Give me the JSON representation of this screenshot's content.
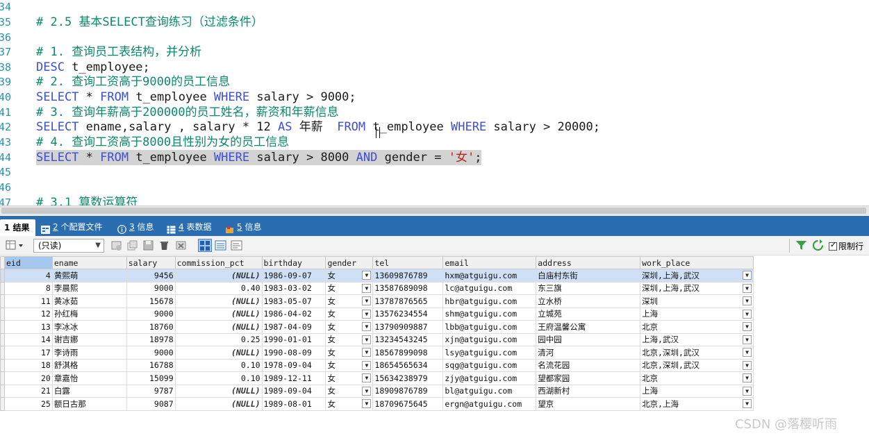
{
  "editor": {
    "lines": [
      {
        "no": "34",
        "segments": []
      },
      {
        "no": "35",
        "segments": [
          {
            "t": "cm",
            "v": "# 2.5 基本SELECT查询练习（过滤条件）"
          }
        ]
      },
      {
        "no": "36",
        "segments": []
      },
      {
        "no": "37",
        "segments": [
          {
            "t": "cm",
            "v": "# 1. 查询员工表结构，并分析"
          }
        ]
      },
      {
        "no": "38",
        "segments": [
          {
            "t": "kw",
            "v": "DESC"
          },
          {
            "t": "tx",
            "v": " t_employee;"
          }
        ]
      },
      {
        "no": "39",
        "segments": [
          {
            "t": "cm",
            "v": "# 2. 查询工资高于9000的员工信息"
          }
        ]
      },
      {
        "no": "40",
        "segments": [
          {
            "t": "kw",
            "v": "SELECT"
          },
          {
            "t": "tx",
            "v": " * "
          },
          {
            "t": "kw",
            "v": "FROM"
          },
          {
            "t": "tx",
            "v": " t_employee "
          },
          {
            "t": "kw",
            "v": "WHERE"
          },
          {
            "t": "tx",
            "v": " salary > 9000;"
          }
        ]
      },
      {
        "no": "41",
        "segments": [
          {
            "t": "cm",
            "v": "# 3. 查询年薪高于200000的员工姓名，薪资和年薪信息"
          }
        ]
      },
      {
        "no": "42",
        "segments": [
          {
            "t": "kw",
            "v": "SELECT"
          },
          {
            "t": "tx",
            "v": " ename,salary , salary * 12 "
          },
          {
            "t": "kw",
            "v": "AS"
          },
          {
            "t": "tx",
            "v": " 年薪  "
          },
          {
            "t": "kw",
            "v": "FROM"
          },
          {
            "t": "tx",
            "v": " t_employee "
          },
          {
            "t": "kw",
            "v": "WHERE"
          },
          {
            "t": "tx",
            "v": " salary > 20000;"
          }
        ]
      },
      {
        "no": "43",
        "segments": [
          {
            "t": "cm",
            "v": "# 4. 查询工资高于8000且性别为女的员工信息"
          }
        ]
      },
      {
        "no": "44",
        "highlight": true,
        "segments": [
          {
            "t": "kw",
            "v": "SELECT"
          },
          {
            "t": "tx",
            "v": " * "
          },
          {
            "t": "kw",
            "v": "FROM"
          },
          {
            "t": "tx",
            "v": " t_employee "
          },
          {
            "t": "kw",
            "v": "WHERE"
          },
          {
            "t": "tx",
            "v": " salary > 8000 "
          },
          {
            "t": "kw",
            "v": "AND"
          },
          {
            "t": "tx",
            "v": " gender = "
          },
          {
            "t": "str",
            "v": "'女'"
          },
          {
            "t": "tx",
            "v": ";"
          }
        ]
      },
      {
        "no": "45",
        "segments": []
      },
      {
        "no": "46",
        "segments": []
      },
      {
        "no": "47",
        "segments": [
          {
            "t": "cm",
            "v": "# 3.1 算数运算符"
          }
        ]
      }
    ]
  },
  "tabs": [
    {
      "num": "1",
      "label": "结果",
      "icon": "result-grid-icon"
    },
    {
      "num": "2",
      "label": "个配置文件",
      "icon": "profile-icon"
    },
    {
      "num": "3",
      "label": "信息",
      "icon": "info-icon"
    },
    {
      "num": "4",
      "label": "表数据",
      "icon": "table-data-icon"
    },
    {
      "num": "5",
      "label": "信息",
      "icon": "info-icon-2"
    }
  ],
  "toolbar": {
    "mode": "(只读)",
    "limit_label": "限制行"
  },
  "grid": {
    "columns": [
      "eid",
      "ename",
      "salary",
      "commission_pct",
      "birthday",
      "gender",
      "tel",
      "email",
      "address",
      "work_place"
    ],
    "rows": [
      [
        "4",
        "黄熙萌",
        "9456",
        "(NULL)",
        "1986-09-07",
        "女",
        "13609876789",
        "hxm@atguigu.com",
        "白庙村东街",
        "深圳,上海,武汉"
      ],
      [
        "8",
        "李晨熙",
        "9000",
        "0.40",
        "1983-03-02",
        "女",
        "13587689098",
        "lc@atguigu.com",
        "东三旗",
        "深圳,上海,武汉"
      ],
      [
        "11",
        "黄冰茹",
        "15678",
        "(NULL)",
        "1983-05-07",
        "女",
        "13787876565",
        "hbr@atguigu.com",
        "立水桥",
        "深圳"
      ],
      [
        "12",
        "孙红梅",
        "9000",
        "(NULL)",
        "1986-04-02",
        "女",
        "13576234554",
        "shm@atguigu.com",
        "立城苑",
        "上海"
      ],
      [
        "13",
        "李冰冰",
        "18760",
        "(NULL)",
        "1987-04-09",
        "女",
        "13790909887",
        "lbb@atguigu.com",
        "王府温馨公寓",
        "北京"
      ],
      [
        "14",
        "谢吉娜",
        "18978",
        "0.25",
        "1990-01-01",
        "女",
        "13234543245",
        "xjn@atguigu.com",
        "园中园",
        "上海,武汉"
      ],
      [
        "17",
        "李诗雨",
        "9000",
        "(NULL)",
        "1990-08-09",
        "女",
        "18567899098",
        "lsy@atguigu.com",
        "清河",
        "北京,深圳,武汉"
      ],
      [
        "18",
        "舒淇格",
        "16788",
        "0.10",
        "1978-09-04",
        "女",
        "18654565634",
        "sqg@atguigu.com",
        "名流花园",
        "北京,深圳,武汉"
      ],
      [
        "20",
        "章嘉怡",
        "15099",
        "0.10",
        "1989-12-11",
        "女",
        "15634238979",
        "zjy@atguigu.com",
        "望都家园",
        "北京"
      ],
      [
        "21",
        "白露",
        "9787",
        "(NULL)",
        "1989-09-04",
        "女",
        "18909876789",
        "bl@atguigu.com",
        "西湖新村",
        "上海"
      ],
      [
        "25",
        "额日古那",
        "9087",
        "(NULL)",
        "1989-08-01",
        "女",
        "18709675645",
        "ergn@atguigu.com",
        "望京",
        "北京,上海"
      ]
    ]
  },
  "watermark": "CSDN @落樱听雨",
  "colors": {
    "tab_bar": "#2a6db0",
    "keyword": "#3b4fd0",
    "comment": "#0a8a6a",
    "string": "#c0201a",
    "selected_row": "#cfe0f6"
  }
}
